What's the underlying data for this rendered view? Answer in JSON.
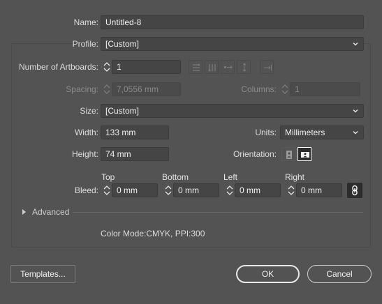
{
  "dialog": {
    "name_label": "Name:",
    "name_value": "Untitled-8",
    "profile_label": "Profile:",
    "profile_value": "[Custom]",
    "artboards_label": "Number of Artboards:",
    "artboards_value": "1",
    "spacing_label": "Spacing:",
    "spacing_value": "7,0556 mm",
    "columns_label": "Columns:",
    "columns_value": "1",
    "size_label": "Size:",
    "size_value": "[Custom]",
    "width_label": "Width:",
    "width_value": "133 mm",
    "units_label": "Units:",
    "units_value": "Millimeters",
    "height_label": "Height:",
    "height_value": "74 mm",
    "orientation_label": "Orientation:",
    "bleed_label": "Bleed:",
    "bleed_top_label": "Top",
    "bleed_top_value": "0 mm",
    "bleed_bottom_label": "Bottom",
    "bleed_bottom_value": "0 mm",
    "bleed_left_label": "Left",
    "bleed_left_value": "0 mm",
    "bleed_right_label": "Right",
    "bleed_right_value": "0 mm",
    "advanced_label": "Advanced",
    "color_mode_text": "Color Mode:CMYK, PPI:300"
  },
  "footer": {
    "templates_label": "Templates...",
    "ok_label": "OK",
    "cancel_label": "Cancel"
  },
  "icons": {
    "artboard_layout": [
      "grid-by-row-icon",
      "grid-by-column-icon",
      "arrange-by-row-icon",
      "arrange-by-column-icon",
      "right-to-left-icon"
    ],
    "orientation": [
      "portrait-icon",
      "landscape-icon"
    ],
    "bleed_link": "link-icon"
  },
  "state": {
    "orientation_selected": "landscape",
    "bleed_linked": true,
    "advanced_expanded": false
  }
}
